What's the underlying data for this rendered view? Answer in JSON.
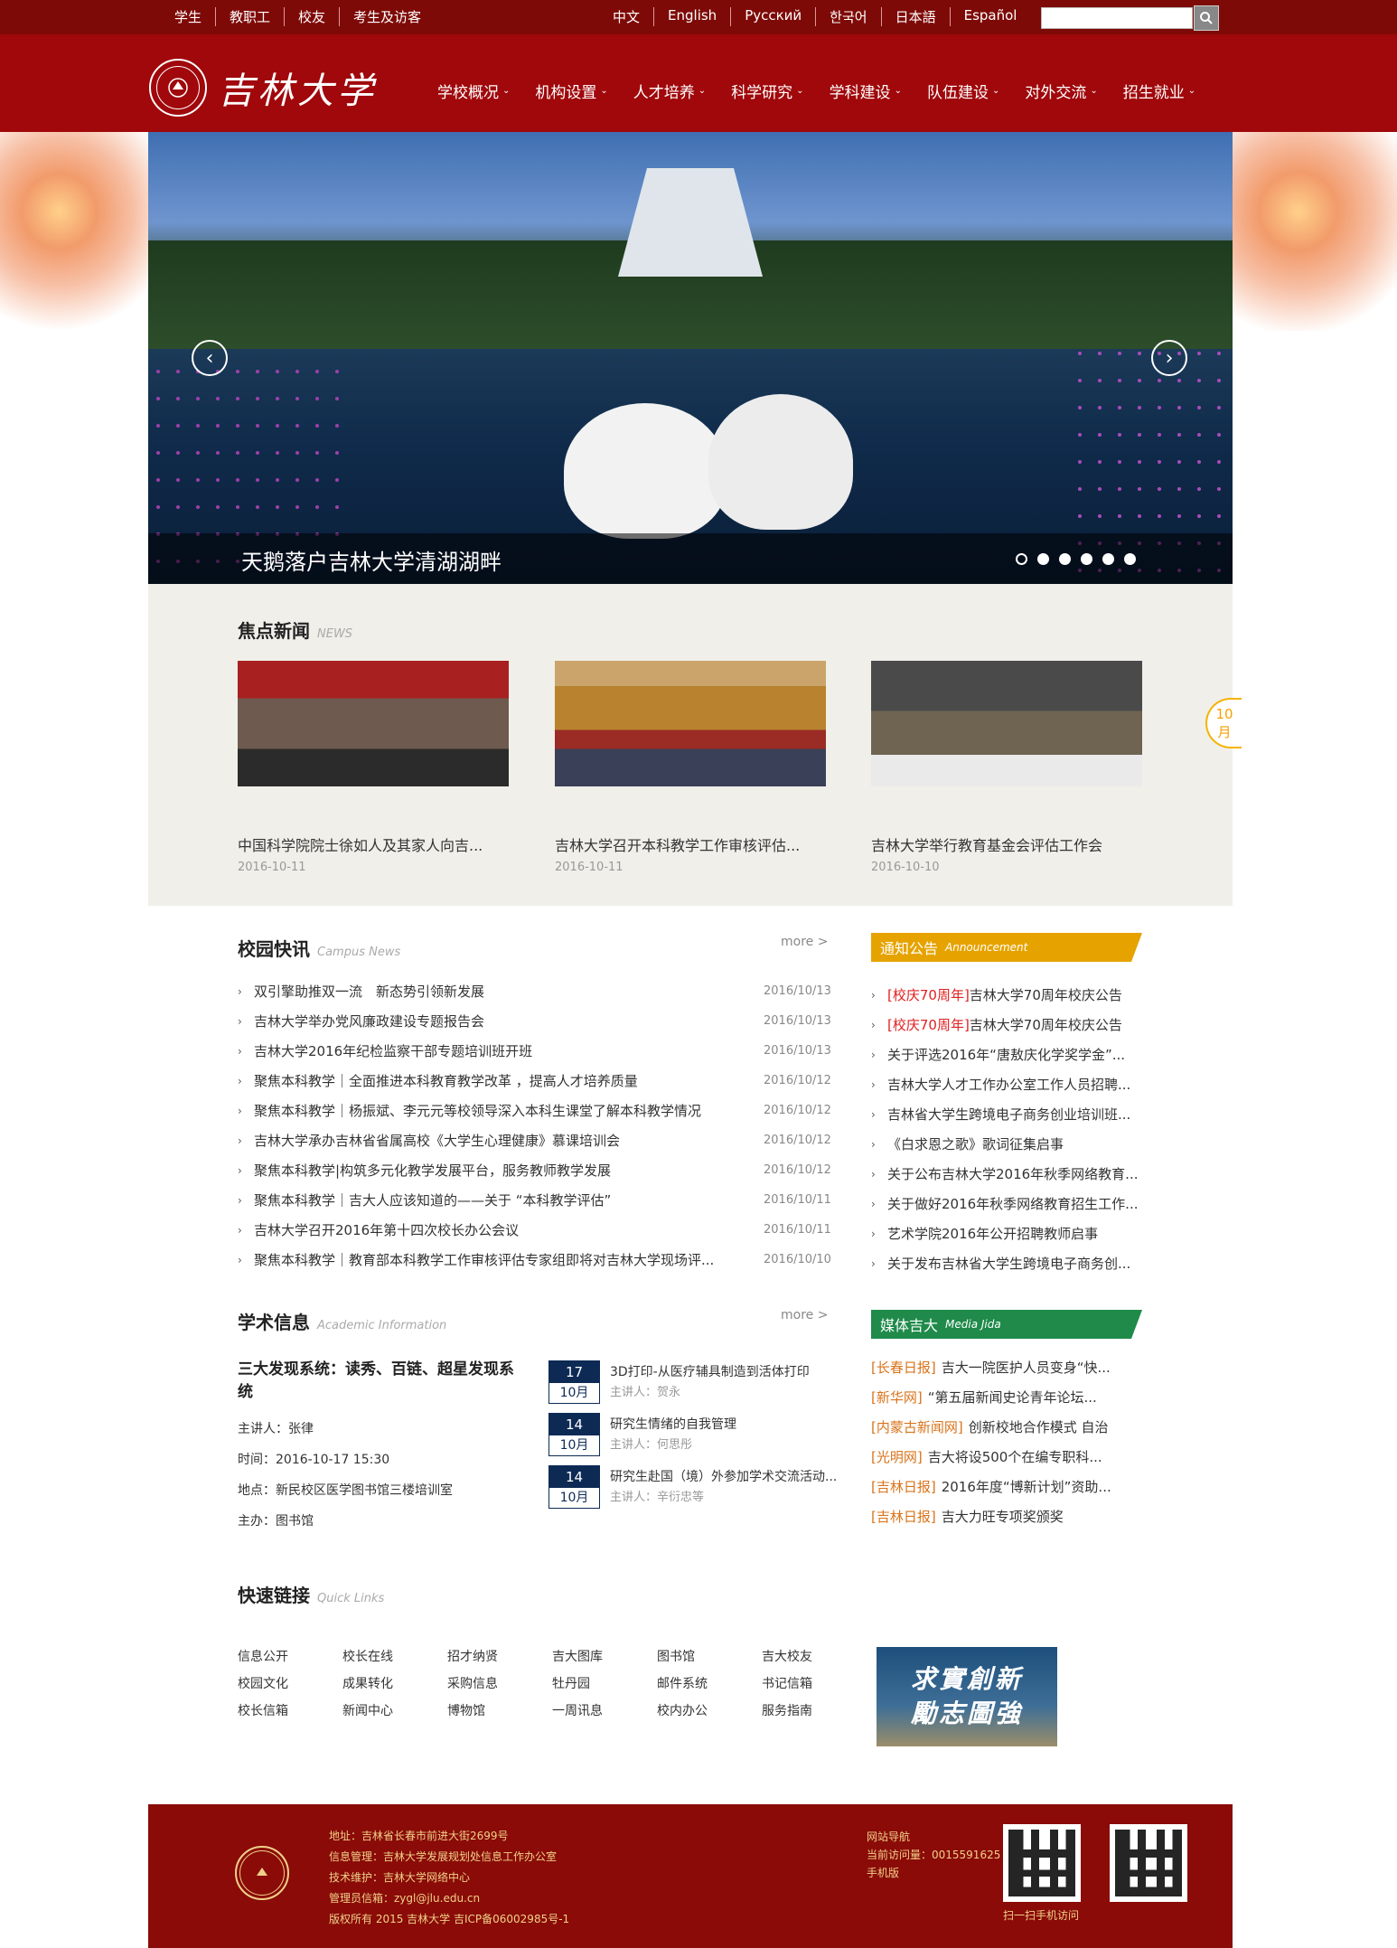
{
  "topbar": {
    "audience": [
      "学生",
      "教职工",
      "校友",
      "考生及访客"
    ],
    "languages": [
      "中文",
      "English",
      "Русский",
      "한국어",
      "日本語",
      "Español"
    ]
  },
  "header": {
    "logo_text": "吉林大学",
    "nav": [
      "学校概况",
      "机构设置",
      "人才培养",
      "科学研究",
      "学科建设",
      "队伍建设",
      "对外交流",
      "招生就业"
    ]
  },
  "hero": {
    "caption": "天鹅落户吉林大学清湖湖畔",
    "slide_count": 6,
    "active_slide": 1
  },
  "focus": {
    "title": "焦点新闻",
    "subtitle": "NEWS",
    "items": [
      {
        "title": "中国科学院院士徐如人及其家人向吉...",
        "date": "2016-10-11"
      },
      {
        "title": "吉林大学召开本科教学工作审核评估...",
        "date": "2016-10-11"
      },
      {
        "title": "吉林大学举行教育基金会评估工作会",
        "date": "2016-10-10"
      }
    ],
    "badge_day": "10",
    "badge_unit": "月"
  },
  "campus": {
    "title": "校园快讯",
    "subtitle": "Campus News",
    "more": "more >",
    "items": [
      {
        "title": "双引擎助推双一流　新态势引领新发展",
        "date": "2016/10/13"
      },
      {
        "title": "吉林大学举办党风廉政建设专题报告会",
        "date": "2016/10/13"
      },
      {
        "title": "吉林大学2016年纪检监察干部专题培训班开班",
        "date": "2016/10/13"
      },
      {
        "title": "聚焦本科教学｜全面推进本科教育教学改革 ，提高人才培养质量",
        "date": "2016/10/12"
      },
      {
        "title": "聚焦本科教学｜杨振斌、李元元等校领导深入本科生课堂了解本科教学情况",
        "date": "2016/10/12"
      },
      {
        "title": "吉林大学承办吉林省省属高校《大学生心理健康》慕课培训会",
        "date": "2016/10/12"
      },
      {
        "title": "聚焦本科教学|构筑多元化教学发展平台，服务教师教学发展",
        "date": "2016/10/12"
      },
      {
        "title": "聚焦本科教学｜吉大人应该知道的——关于 “本科教学评估”",
        "date": "2016/10/11"
      },
      {
        "title": "吉林大学召开2016年第十四次校长办公会议",
        "date": "2016/10/11"
      },
      {
        "title": "聚焦本科教学｜教育部本科教学工作审核评估专家组即将对吉林大学现场评...",
        "date": "2016/10/10"
      }
    ]
  },
  "announcement": {
    "title": "通知公告",
    "subtitle": "Announcement",
    "items": [
      {
        "tag": "[校庆70周年]",
        "title": "吉林大学70周年校庆公告"
      },
      {
        "tag": "[校庆70周年]",
        "title": "吉林大学70周年校庆公告"
      },
      {
        "tag": "",
        "title": "关于评选2016年“唐敖庆化学奖学金”..."
      },
      {
        "tag": "",
        "title": "吉林大学人才工作办公室工作人员招聘..."
      },
      {
        "tag": "",
        "title": "吉林省大学生跨境电子商务创业培训班..."
      },
      {
        "tag": "",
        "title": "《白求恩之歌》歌词征集启事"
      },
      {
        "tag": "",
        "title": "关于公布吉林大学2016年秋季网络教育..."
      },
      {
        "tag": "",
        "title": "关于做好2016年秋季网络教育招生工作..."
      },
      {
        "tag": "",
        "title": "艺术学院2016年公开招聘教师启事"
      },
      {
        "tag": "",
        "title": "关于发布吉林省大学生跨境电子商务创..."
      }
    ]
  },
  "academic": {
    "title": "学术信息",
    "subtitle": "Academic Information",
    "more": "more >",
    "featured": {
      "title": "三大发现系统：读秀、百链、超星发现系统",
      "speaker": "主讲人：张律",
      "time": "时间：2016-10-17 15:30",
      "place": "地点：新民校区医学图书馆三楼培训室",
      "host": "主办：图书馆"
    },
    "lectures": [
      {
        "day": "17",
        "month": "10月",
        "title": "3D打印-从医疗辅具制造到活体打印",
        "speaker": "主讲人：贺永"
      },
      {
        "day": "14",
        "month": "10月",
        "title": "研究生情绪的自我管理",
        "speaker": "主讲人：何思彤"
      },
      {
        "day": "14",
        "month": "10月",
        "title": "研究生赴国（境）外参加学术交流活动...",
        "speaker": "主讲人：辛衍忠等"
      }
    ]
  },
  "media": {
    "title": "媒体吉大",
    "subtitle": "Media Jida",
    "items": [
      {
        "tag": "[长春日报]",
        "title": "吉大一院医护人员变身“快..."
      },
      {
        "tag": "[新华网]",
        "title": "“第五届新闻史论青年论坛..."
      },
      {
        "tag": "[内蒙古新闻网]",
        "title": "创新校地合作模式 自治"
      },
      {
        "tag": "[光明网]",
        "title": "吉大将设500个在编专职科..."
      },
      {
        "tag": "[吉林日报]",
        "title": "2016年度“博新计划”资助..."
      },
      {
        "tag": "[吉林日报]",
        "title": "吉大力旺专项奖颁奖"
      }
    ]
  },
  "quicklinks": {
    "title": "快速链接",
    "subtitle": "Quick Links",
    "links": [
      "信息公开",
      "校长在线",
      "招才纳贤",
      "吉大图库",
      "图书馆",
      "吉大校友",
      "校园文化",
      "成果转化",
      "采购信息",
      "牡丹园",
      "邮件系统",
      "书记信箱",
      "校长信箱",
      "新闻中心",
      "博物馆",
      "一周讯息",
      "校内办公",
      "服务指南"
    ],
    "slogan_line1": "求實創新",
    "slogan_line2": "勵志圖強"
  },
  "footer": {
    "address": "地址：吉林省长春市前进大街2699号",
    "info_mgmt": "信息管理：吉林大学发展规划处信息工作办公室",
    "tech": "技术维护：吉林大学网络中心",
    "admin_mail": "管理员信箱：zygl@jlu.edu.cn",
    "copyright": "版权所有 2015 吉林大学 吉ICP备06002985号-1",
    "site_nav": "网站导航",
    "visits": "当前访问量：0015591625",
    "mobile": "手机版",
    "qr_caption": "扫一扫手机访问"
  },
  "colors": {
    "brand_red": "#a0080b",
    "dark_red": "#7e0a07",
    "announcement_orange": "#e6a300",
    "media_green": "#1f8a4a",
    "lecture_navy": "#0d2a55"
  }
}
